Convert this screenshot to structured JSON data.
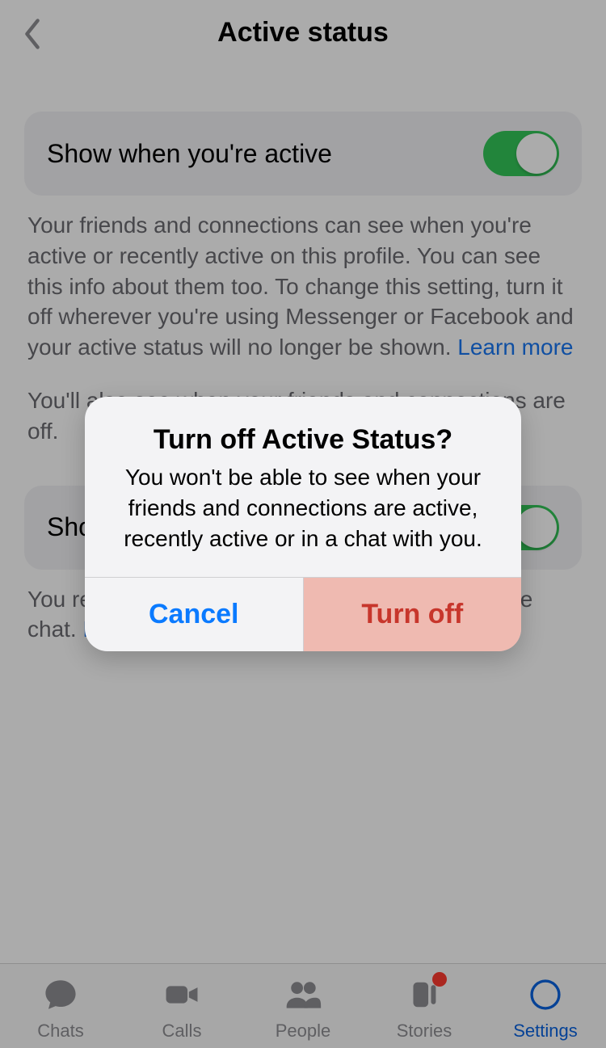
{
  "header": {
    "title": "Active status"
  },
  "section1": {
    "label": "Show when you're active",
    "toggle_on": true,
    "desc": "Your friends and connections can see when you're active or recently active on this profile. You can see this info about them too. To change this setting, turn it off wherever you're using Messenger or Facebook and your active status will no longer be shown.",
    "learn_more": "Learn more",
    "note": "You'll also see when your friends and connections are off."
  },
  "section2": {
    "label": "Show when you're active",
    "toggle_on": true,
    "desc_part1": "You",
    "desc_part2": "re both",
    "desc_part3": "to see when they're active in the same chat.  ",
    "learn_more": "Learn more"
  },
  "dialog": {
    "title": "Turn off Active Status?",
    "message": "You won't be able to see when your friends and connections are active, recently active or in a chat with you.",
    "cancel": "Cancel",
    "confirm": "Turn off"
  },
  "tabs": {
    "chats": "Chats",
    "calls": "Calls",
    "people": "People",
    "stories": "Stories",
    "settings": "Settings"
  }
}
